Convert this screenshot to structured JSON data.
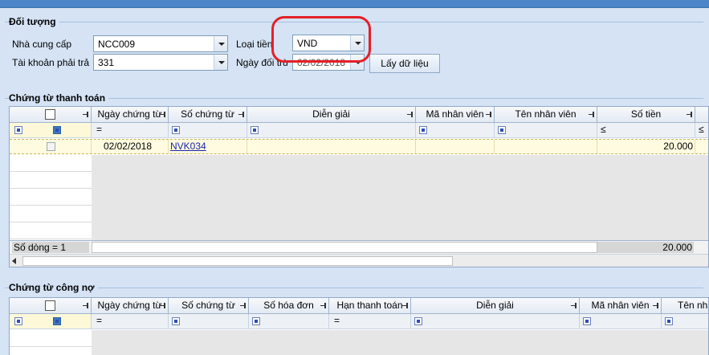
{
  "app": {
    "title_bar": ""
  },
  "doi_tuong": {
    "title": "Đối tượng",
    "nha_cung_cap_label": "Nhà cung cấp",
    "nha_cung_cap_value": "NCC009",
    "tai_khoan_label": "Tài khoản phải trả",
    "tai_khoan_value": "331",
    "loai_tien_label": "Loại tiền",
    "loai_tien_value": "VND",
    "ngay_doi_tru_label": "Ngày đối trừ",
    "ngay_doi_tru_value": "02/02/2018",
    "get_data_button": "Lấy dữ liệu"
  },
  "payment": {
    "title": "Chứng từ thanh toán",
    "columns": [
      "Ngày chứng từ",
      "Số chứng từ",
      "Diễn giải",
      "Mã nhân viên",
      "Tên nhân viên",
      "Số tiền"
    ],
    "filter_op_date": "=",
    "filter_op_amount": "≤",
    "filter_op_amount2": "≤",
    "row": {
      "date": "02/02/2018",
      "doc_no": "NVK034",
      "amount": "20.000"
    },
    "footer_count": "Số dòng = 1",
    "footer_total": "20.000"
  },
  "debt": {
    "title": "Chứng từ công nợ",
    "columns": [
      "Ngày chứng từ",
      "Số chứng từ",
      "Số hóa đơn",
      "Hạn thanh toán",
      "Diễn giải",
      "Mã nhân viên",
      "Tên nhâ"
    ],
    "filter_op_date": "=",
    "filter_op_due": "="
  },
  "colors": {
    "highlight": "#e32028",
    "link": "#1a25a8",
    "background": "#d5e3f5"
  }
}
